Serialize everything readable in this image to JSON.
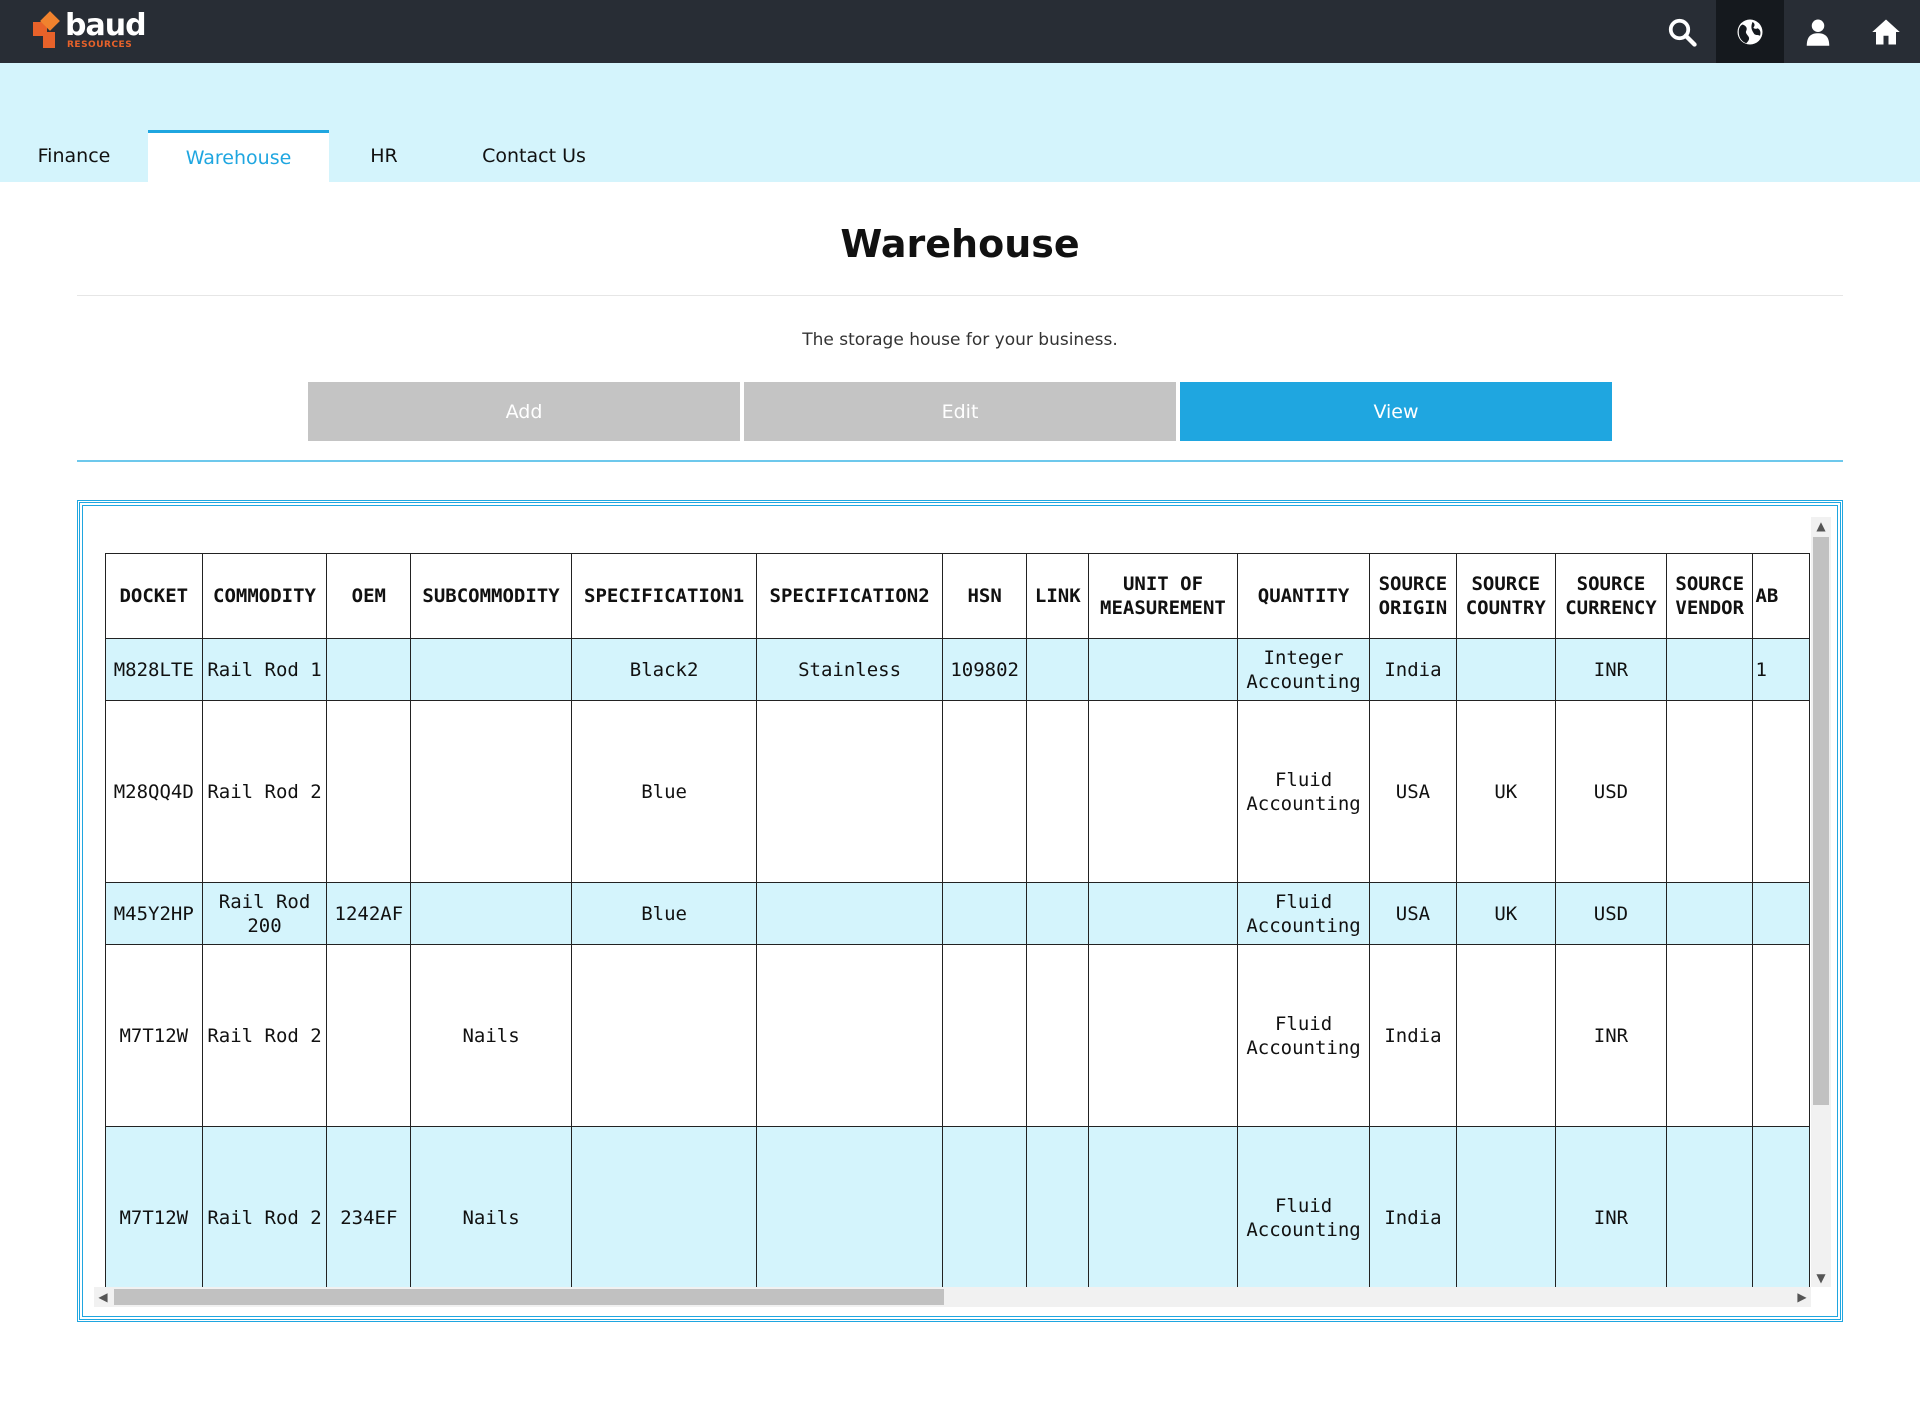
{
  "brand": {
    "name": "baud",
    "sub": "RESOURCES",
    "accent": "#e8622a"
  },
  "topbar": {
    "background": "#282d35",
    "icons": [
      "search-icon",
      "globe-icon",
      "user-icon",
      "home-icon"
    ]
  },
  "nav": {
    "tabs": [
      {
        "label": "Finance"
      },
      {
        "label": "Warehouse",
        "active": true
      },
      {
        "label": "HR"
      },
      {
        "label": "Contact Us"
      }
    ]
  },
  "page": {
    "title": "Warehouse",
    "subtitle": "The storage house for your business."
  },
  "actions": {
    "add": "Add",
    "edit": "Edit",
    "view": "View",
    "active": "View"
  },
  "colors": {
    "accent": "#1fa6e0",
    "band": "#d4f4fc",
    "button_disabled": "#c4c4c4"
  },
  "table": {
    "headers": [
      "DOCKET",
      "COMMODITY",
      "OEM",
      "SUBCOMMODITY",
      "SPECIFICATION1",
      "SPECIFICATION2",
      "HSN",
      "LINK",
      "UNIT OF MEASUREMENT",
      "QUANTITY",
      "SOURCE ORIGIN",
      "SOURCE COUNTRY",
      "SOURCE CURRENCY",
      "SOURCE VENDOR",
      "AB"
    ],
    "rows": [
      [
        "M828LTE",
        "Rail Rod 1",
        "",
        "",
        "Black2",
        "Stainless",
        "109802",
        "",
        "",
        "Integer Accounting",
        "India",
        "",
        "INR",
        "",
        "1"
      ],
      [
        "M28QQ4D",
        "Rail Rod 2",
        "",
        "",
        "Blue",
        "",
        "",
        "",
        "",
        "Fluid Accounting",
        "USA",
        "UK",
        "USD",
        "",
        ""
      ],
      [
        "M45Y2HP",
        "Rail Rod 200",
        "1242AF",
        "",
        "Blue",
        "",
        "",
        "",
        "",
        "Fluid Accounting",
        "USA",
        "UK",
        "USD",
        "",
        ""
      ],
      [
        "M7T12W",
        "Rail Rod 2",
        "",
        "Nails",
        "",
        "",
        "",
        "",
        "",
        "Fluid Accounting",
        "India",
        "",
        "INR",
        "",
        ""
      ],
      [
        "M7T12W",
        "Rail Rod 2",
        "234EF",
        "Nails",
        "",
        "",
        "",
        "",
        "",
        "Fluid Accounting",
        "India",
        "",
        "INR",
        "",
        ""
      ]
    ]
  }
}
